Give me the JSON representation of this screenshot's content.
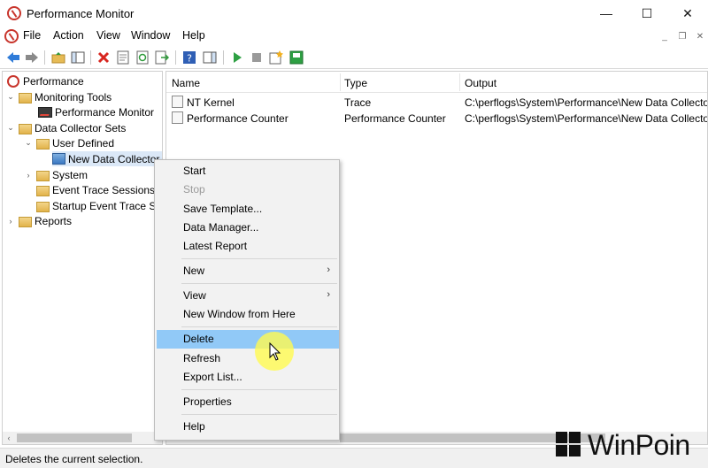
{
  "window": {
    "title": "Performance Monitor",
    "controls": {
      "minimize": "—",
      "maximize": "☐",
      "close": "✕"
    }
  },
  "menubar": {
    "items": [
      "File",
      "Action",
      "View",
      "Window",
      "Help"
    ]
  },
  "tree": {
    "items": [
      {
        "label": "Performance",
        "icon": "performance-icon"
      },
      {
        "label": "Monitoring Tools",
        "icon": "folder-icon"
      },
      {
        "label": "Performance Monitor",
        "icon": "monitor-icon"
      },
      {
        "label": "Data Collector Sets",
        "icon": "folder-icon"
      },
      {
        "label": "User Defined",
        "icon": "folder-icon"
      },
      {
        "label": "New Data Collector",
        "icon": "data-collector-icon"
      },
      {
        "label": "System",
        "icon": "folder-icon"
      },
      {
        "label": "Event Trace Sessions",
        "icon": "folder-icon"
      },
      {
        "label": "Startup Event Trace Se",
        "icon": "folder-icon"
      },
      {
        "label": "Reports",
        "icon": "folder-icon"
      }
    ]
  },
  "list": {
    "columns": [
      "Name",
      "Type",
      "Output"
    ],
    "rows": [
      {
        "name": "NT Kernel",
        "type": "Trace",
        "output": "C:\\perflogs\\System\\Performance\\New Data Collector"
      },
      {
        "name": "Performance Counter",
        "type": "Performance Counter",
        "output": "C:\\perflogs\\System\\Performance\\New Data Collector"
      }
    ]
  },
  "context_menu": {
    "items": [
      {
        "label": "Start",
        "enabled": true
      },
      {
        "label": "Stop",
        "enabled": false
      },
      {
        "label": "Save Template...",
        "enabled": true
      },
      {
        "label": "Data Manager...",
        "enabled": true
      },
      {
        "label": "Latest Report",
        "enabled": true
      },
      {
        "label": "New",
        "enabled": true,
        "submenu": true
      },
      {
        "label": "View",
        "enabled": true,
        "submenu": true
      },
      {
        "label": "New Window from Here",
        "enabled": true
      },
      {
        "label": "Delete",
        "enabled": true,
        "highlighted": true
      },
      {
        "label": "Refresh",
        "enabled": true
      },
      {
        "label": "Export List...",
        "enabled": true
      },
      {
        "label": "Properties",
        "enabled": true
      },
      {
        "label": "Help",
        "enabled": true
      }
    ]
  },
  "statusbar": {
    "text": "Deletes the current selection."
  },
  "watermark": {
    "text": "WinPoin"
  },
  "colors": {
    "highlight": "#91c9f7",
    "selection": "#dbe8f7",
    "cursor_halo": "#fffa50"
  }
}
